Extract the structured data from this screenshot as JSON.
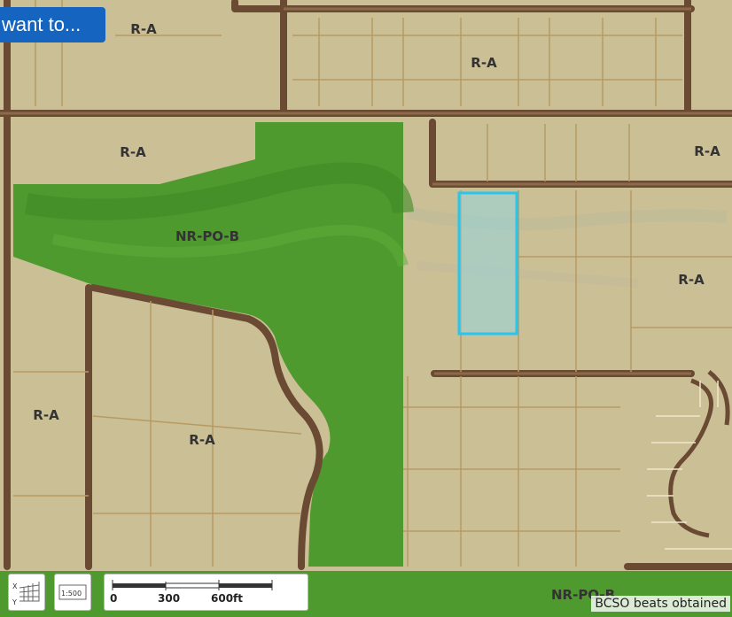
{
  "action_button": {
    "label": "want to..."
  },
  "map": {
    "zones": [
      {
        "id": "ra-1",
        "label": "R-A"
      },
      {
        "id": "ra-2",
        "label": "R-A"
      },
      {
        "id": "ra-3",
        "label": "R-A"
      },
      {
        "id": "ra-4",
        "label": "R-A"
      },
      {
        "id": "ra-5",
        "label": "R-A"
      },
      {
        "id": "ra-6",
        "label": "R-A"
      },
      {
        "id": "ra-7",
        "label": "R-A"
      },
      {
        "id": "nr-1",
        "label": "NR-PO-B"
      },
      {
        "id": "nr-2",
        "label": "NR-PO-B"
      }
    ],
    "colors": {
      "ra_fill": "#cbbf96",
      "nr_fill": "#4f9a2e",
      "road": "#6b4a33",
      "parcel_line": "#b79a62",
      "selection": "#26c6f0"
    }
  },
  "toolbar": {
    "coordinate_tool_icon": "xy-grid-icon",
    "scale_tool_label": "1:500",
    "scalebar": {
      "ticks": [
        "0",
        "300",
        "600ft"
      ]
    }
  },
  "attribution": "BCSO beats obtained"
}
